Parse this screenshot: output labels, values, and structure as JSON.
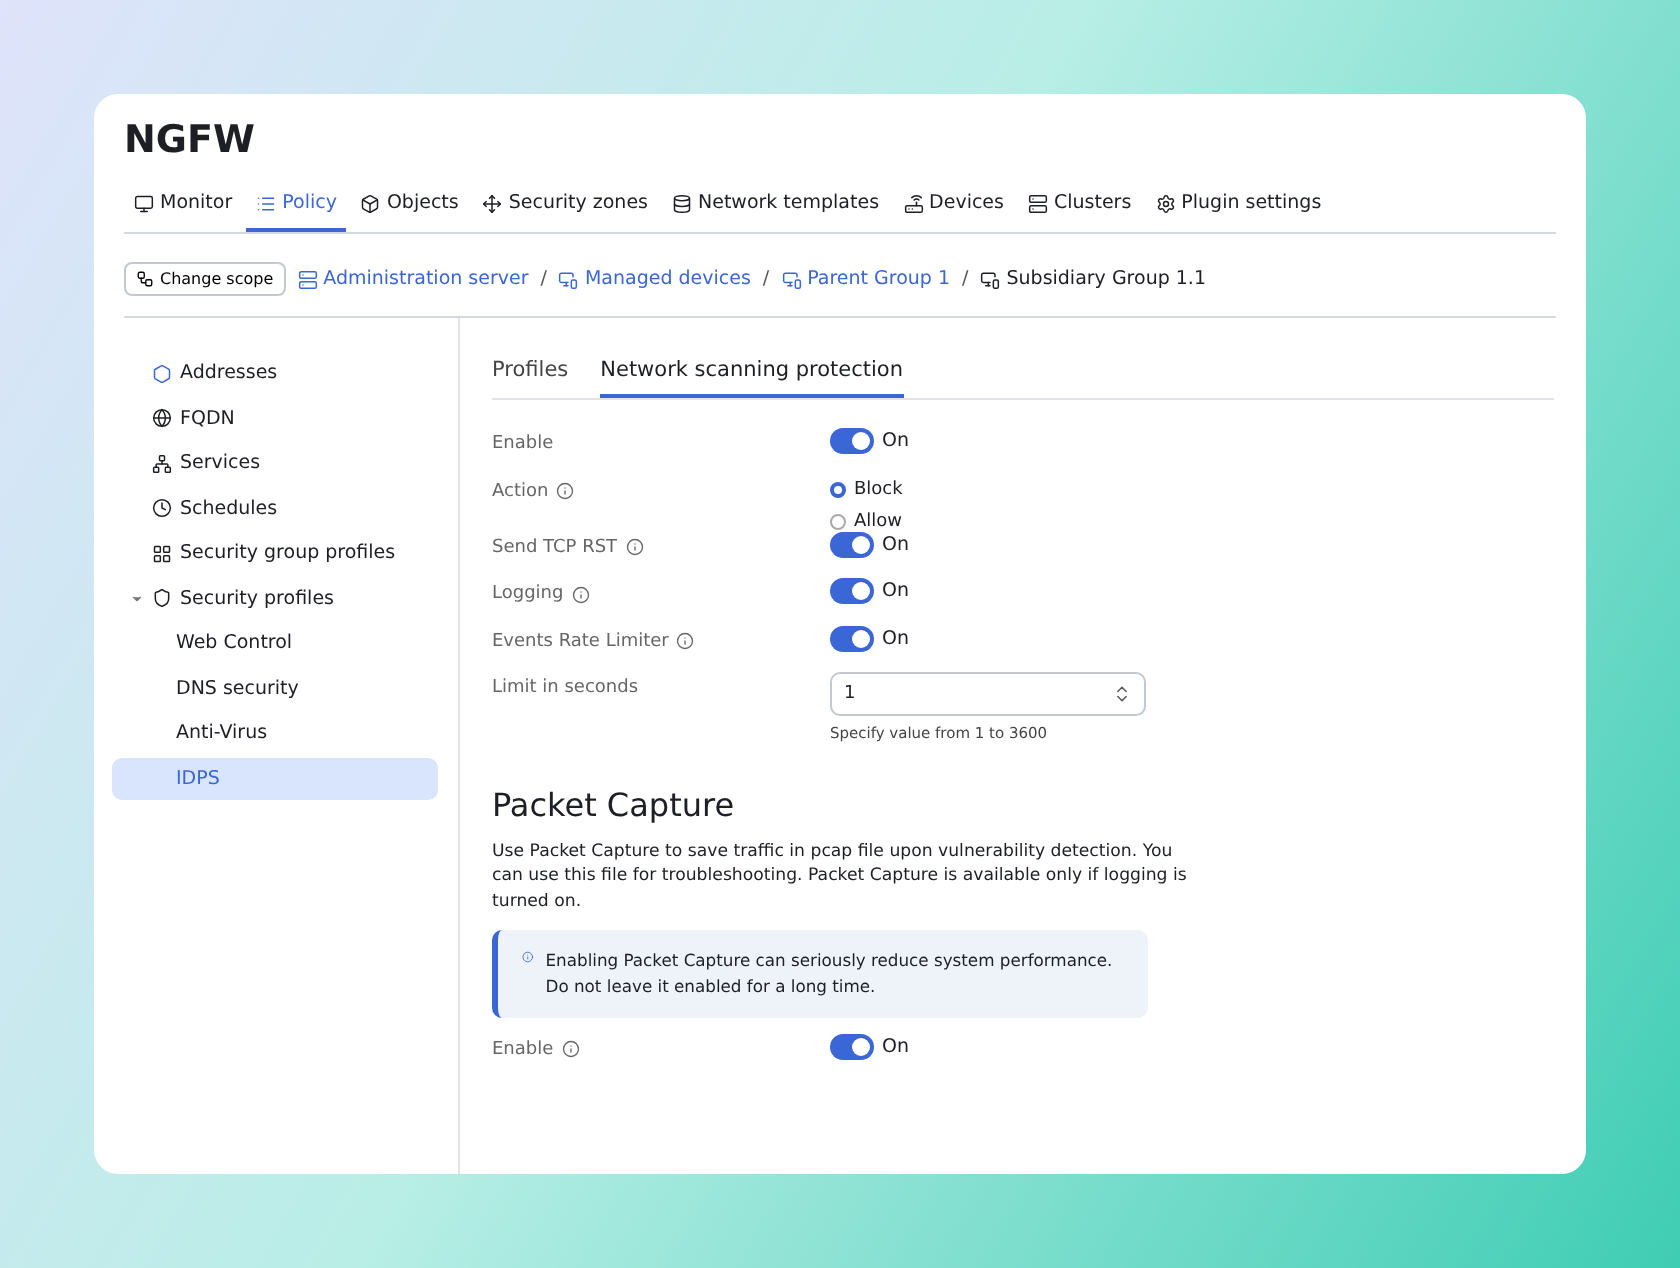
{
  "app": {
    "title": "NGFW"
  },
  "nav_tabs": [
    {
      "label": "Monitor",
      "selected": false
    },
    {
      "label": "Policy",
      "selected": true
    },
    {
      "label": "Objects",
      "selected": false
    },
    {
      "label": "Security zones",
      "selected": false
    },
    {
      "label": "Network templates",
      "selected": false
    },
    {
      "label": "Devices",
      "selected": false
    },
    {
      "label": "Clusters",
      "selected": false
    },
    {
      "label": "Plugin settings",
      "selected": false
    }
  ],
  "breadcrumb": {
    "scope_button": "Change scope",
    "separator": "/",
    "items": [
      {
        "label": "Administration server",
        "current": false
      },
      {
        "label": "Managed devices",
        "current": false
      },
      {
        "label": "Parent Group 1",
        "current": false
      },
      {
        "label": "Subsidiary Group 1.1",
        "current": true
      }
    ]
  },
  "sidebar": {
    "items": [
      {
        "label": "Addresses",
        "selected": false
      },
      {
        "label": "FQDN",
        "selected": false
      },
      {
        "label": "Services",
        "selected": false
      },
      {
        "label": "Schedules",
        "selected": false
      },
      {
        "label": "Security group profiles",
        "selected": false
      },
      {
        "label": "Security profiles",
        "selected": false,
        "expanded": true,
        "children": [
          {
            "label": "Web Control",
            "selected": false
          },
          {
            "label": "DNS security",
            "selected": false
          },
          {
            "label": "Anti-Virus",
            "selected": false
          },
          {
            "label": "IDPS",
            "selected": true
          }
        ]
      }
    ]
  },
  "content_tabs": [
    {
      "label": "Profiles",
      "selected": false
    },
    {
      "label": "Network scanning protection",
      "selected": true
    }
  ],
  "form": [
    {
      "kind": "toggle",
      "label": "Enable",
      "info": false,
      "on": true,
      "state_text": "On"
    },
    {
      "kind": "radio",
      "label": "Action",
      "info": true,
      "options": [
        {
          "label": "Block",
          "selected": true
        },
        {
          "label": "Allow",
          "selected": false
        }
      ]
    },
    {
      "kind": "toggle",
      "label": "Send TCP RST",
      "info": true,
      "on": true,
      "state_text": "On"
    },
    {
      "kind": "toggle",
      "label": "Logging",
      "info": true,
      "on": true,
      "state_text": "On"
    },
    {
      "kind": "toggle",
      "label": "Events Rate Limiter",
      "info": true,
      "on": true,
      "state_text": "On"
    },
    {
      "kind": "number",
      "label": "Limit in seconds",
      "info": false,
      "value": "1",
      "hint": "Specify value from 1 to 3600"
    }
  ],
  "packet_capture": {
    "title": "Packet Capture",
    "description": "Use Packet Capture to save traffic in pcap file upon vulnerability detection. You can use this file for troubleshooting. Packet Capture is available only if logging is turned on.",
    "notice": "Enabling Packet Capture can seriously reduce system performance. Do not leave it enabled for a long time.",
    "form": [
      {
        "kind": "toggle",
        "label": "Enable",
        "info": true,
        "on": true,
        "state_text": "On"
      }
    ]
  }
}
